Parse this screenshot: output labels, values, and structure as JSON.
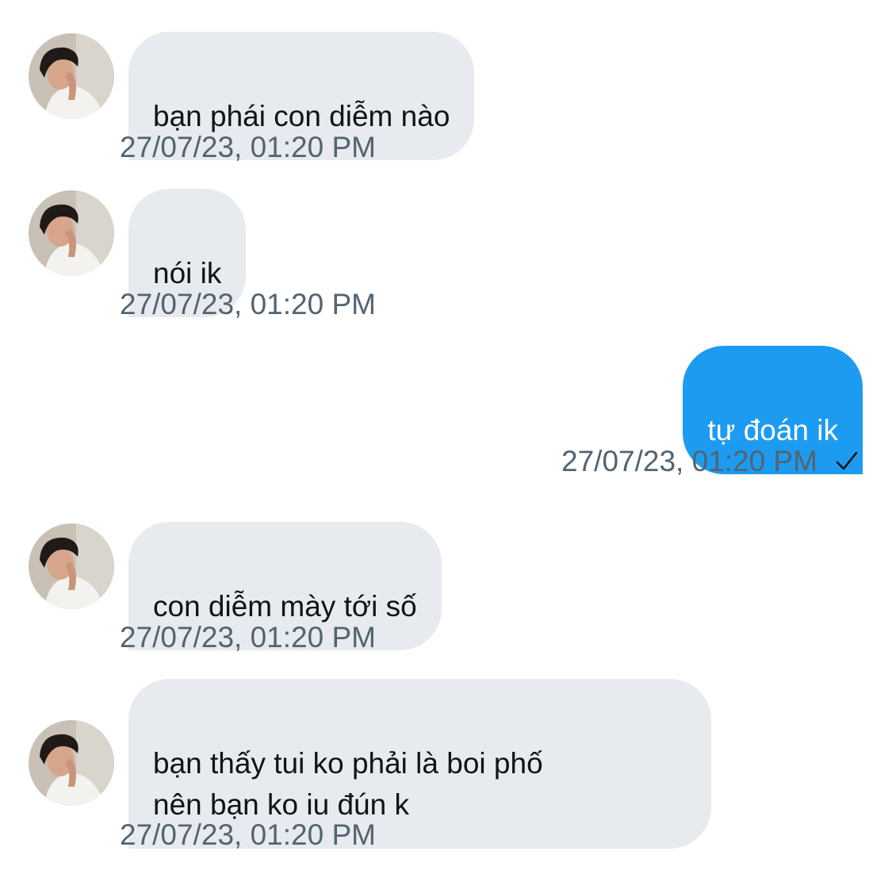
{
  "messages": [
    {
      "direction": "incoming",
      "text": "bạn phái con diễm nào",
      "timestamp": "27/07/23, 01:20 PM"
    },
    {
      "direction": "incoming",
      "text": "nói ik",
      "timestamp": "27/07/23, 01:20 PM"
    },
    {
      "direction": "outgoing",
      "text": "tự đoán ik",
      "timestamp": "27/07/23, 01:20 PM",
      "status_icon": "checkmark-icon"
    },
    {
      "direction": "incoming",
      "text": "con diễm mày tới số",
      "timestamp": "27/07/23, 01:20 PM"
    },
    {
      "direction": "incoming",
      "text": "bạn thấy tui ko phải là boi phố\nnên bạn ko iu đún k",
      "timestamp": "27/07/23, 01:20 PM"
    }
  ],
  "colors": {
    "incoming_bubble": "#e7eaee",
    "outgoing_bubble": "#1d9bf0",
    "timestamp_text": "#536471",
    "message_text": "#0f1419"
  },
  "icons": {
    "avatar": "user-avatar-photo",
    "read_status": "checkmark-icon"
  }
}
